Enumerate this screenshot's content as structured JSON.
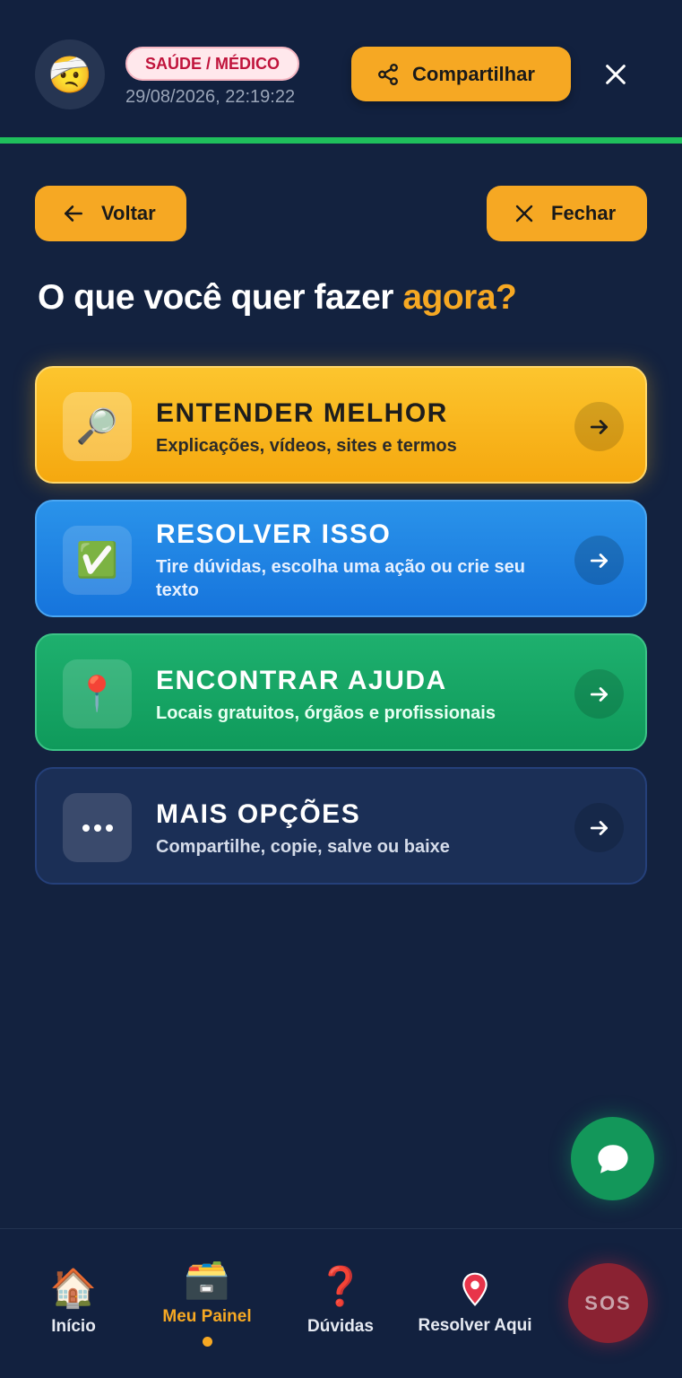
{
  "header": {
    "avatar_emoji": "🤕",
    "category_badge": "SAÚDE / MÉDICO",
    "timestamp": "29/08/2026, 22:19:22",
    "share_label": "Compartilhar",
    "progress_color": "#1fbf5c"
  },
  "nav": {
    "back_label": "Voltar",
    "close_label": "Fechar"
  },
  "question": {
    "main": "O que você quer fazer ",
    "accent": "agora?"
  },
  "cards": [
    {
      "icon": "🔎",
      "icon_name": "magnifier-icon",
      "title": "ENTENDER MELHOR",
      "subtitle": "Explicações, vídeos, sites e termos",
      "color": "#f9b61f"
    },
    {
      "icon": "✅",
      "icon_name": "check-icon",
      "title": "RESOLVER ISSO",
      "subtitle": "Tire dúvidas, escolha uma ação ou crie seu texto",
      "color": "#2086e3"
    },
    {
      "icon": "📍",
      "icon_name": "location-pin-icon",
      "title": "ENCONTRAR AJUDA",
      "subtitle": "Locais gratuitos, órgãos e profissionais",
      "color": "#17a564"
    },
    {
      "icon": "•••",
      "icon_name": "more-icon",
      "title": "MAIS OPÇÕES",
      "subtitle": "Compartilhe, copie, salve ou baixe",
      "color": "#1b2f56"
    }
  ],
  "bottom_nav": {
    "items": [
      {
        "label": "Início",
        "icon": "🏠",
        "icon_name": "home-icon"
      },
      {
        "label": "Meu Painel",
        "icon": "🗃️",
        "icon_name": "file-cabinet-icon",
        "active": true
      },
      {
        "label": "Dúvidas",
        "icon": "❓",
        "icon_name": "question-icon"
      },
      {
        "label": "Resolver Aqui",
        "icon": "📍",
        "icon_name": "location-pin-icon"
      }
    ],
    "sos_label": "SOS"
  },
  "colors": {
    "background": "#13223f",
    "accent": "#f6a823",
    "chat_fab": "#13975a",
    "sos": "#8a2232"
  }
}
